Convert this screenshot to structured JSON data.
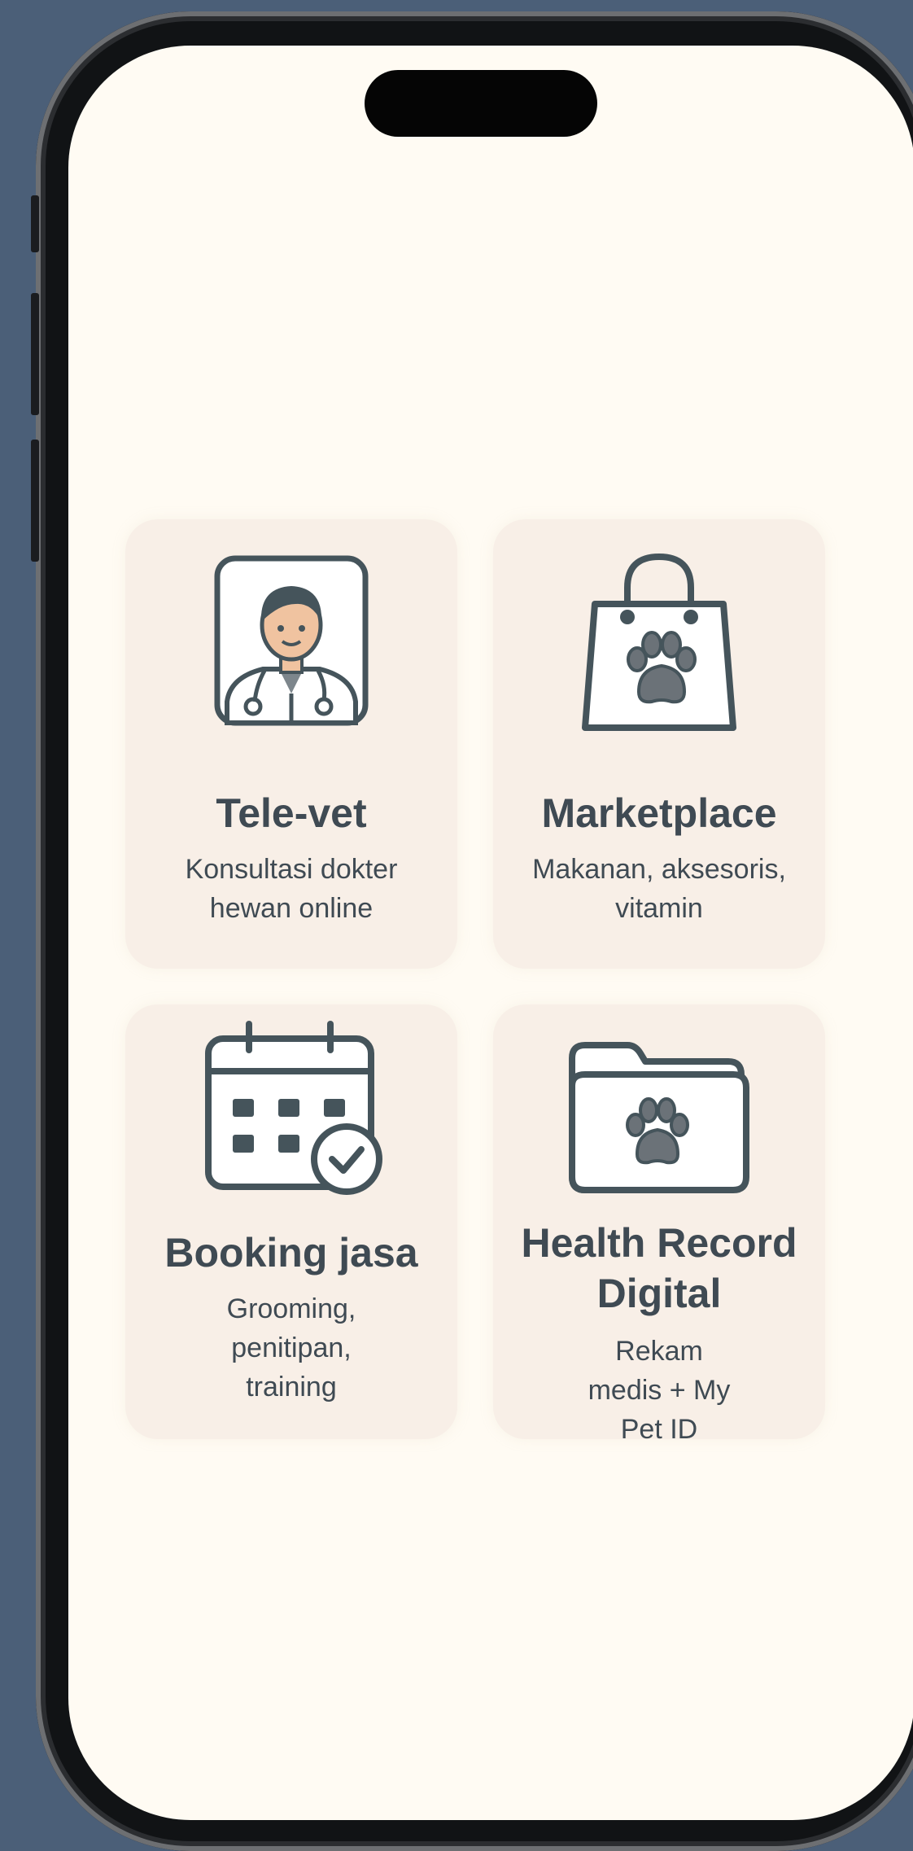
{
  "features": [
    {
      "id": "televet",
      "icon": "doctor-icon",
      "title": "Tele-vet",
      "description": "Konsultasi dokter hewan online"
    },
    {
      "id": "marketplace",
      "icon": "shopping-bag-paw-icon",
      "title": "Marketplace",
      "description": "Makanan, aksesoris, vitamin"
    },
    {
      "id": "booking",
      "icon": "calendar-check-icon",
      "title": "Booking jasa",
      "description": "Grooming, penitipan, training"
    },
    {
      "id": "health-record",
      "icon": "folder-paw-icon",
      "title": "Health Record Digital",
      "description": "Rekam medis + My Pet ID"
    }
  ],
  "colors": {
    "background": "#4b5f78",
    "screen": "#fffbf3",
    "card": "#f8efe7",
    "text": "#3f4a53",
    "icon_stroke": "#45545b",
    "paw_fill": "#6b7278"
  }
}
